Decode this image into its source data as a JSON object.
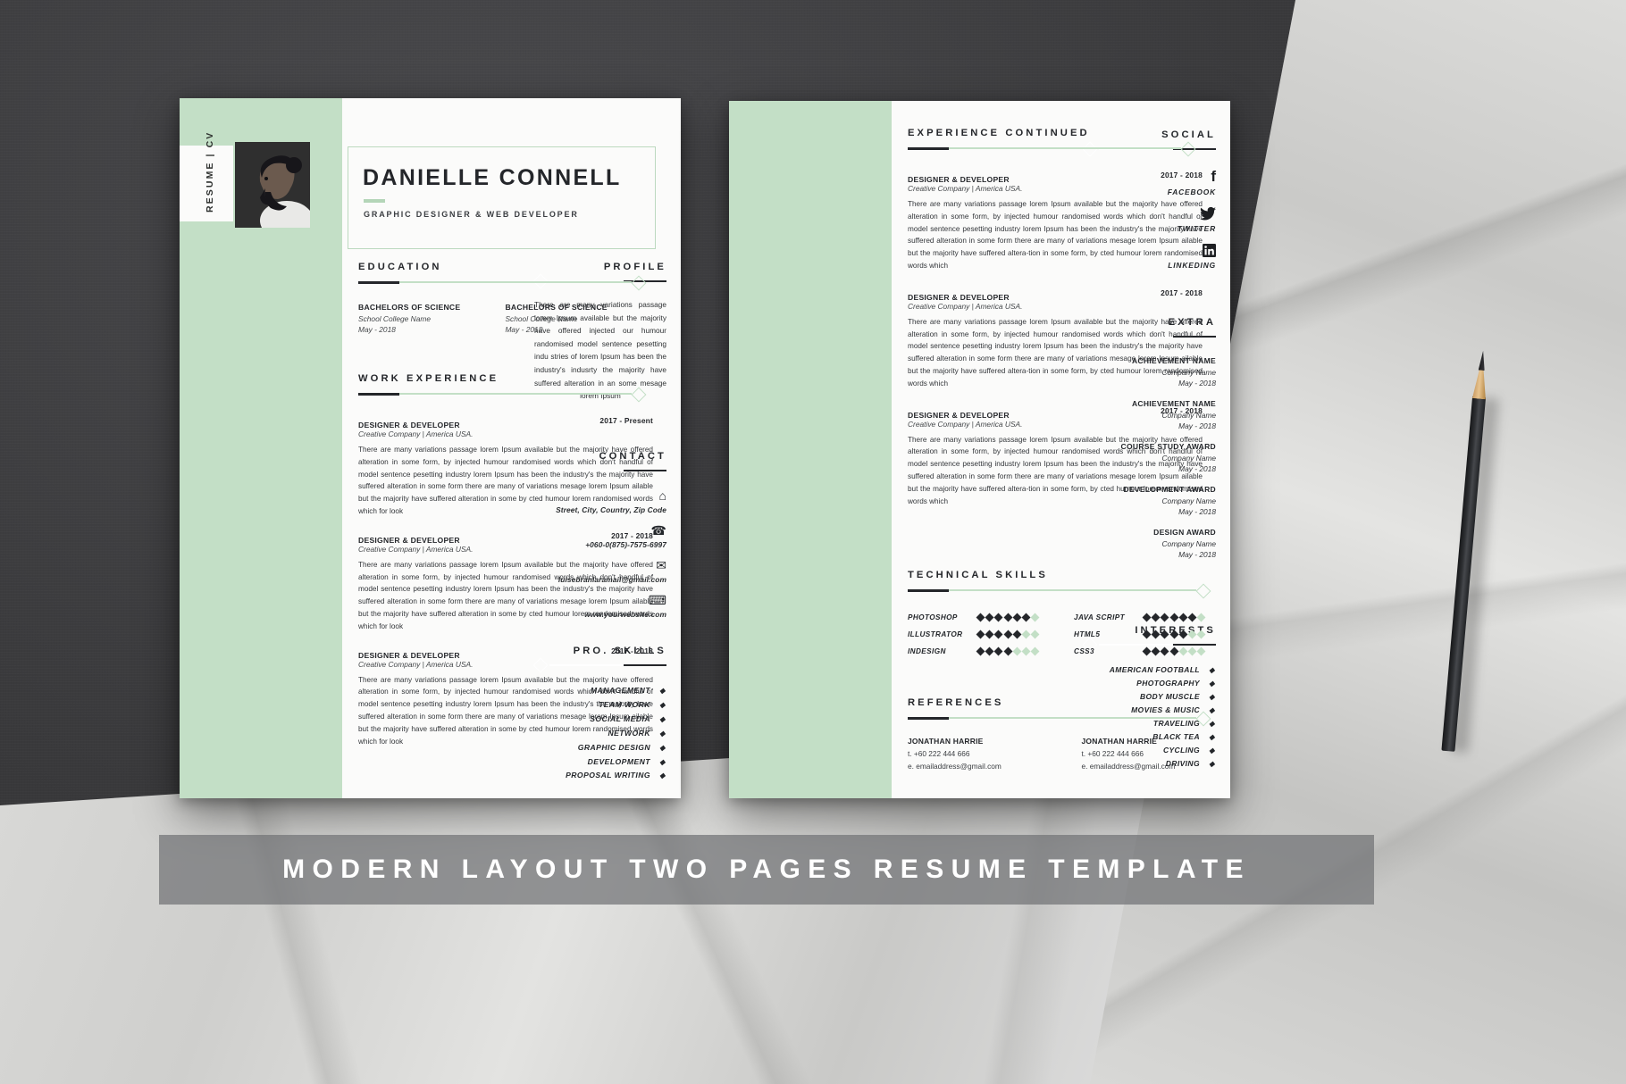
{
  "banner": {
    "text": "MODERN LAYOUT TWO PAGES RESUME TEMPLATE"
  },
  "page1": {
    "vertical_label": "RESUME | CV",
    "name": "DANIELLE CONNELL",
    "role": "GRAPHIC DESIGNER & WEB DEVELOPER",
    "sidebar": {
      "profile": {
        "title": "PROFILE",
        "text": "There are many variations passage lorem Ipsum available but the majority have offered injected our humour randomised model sentence pesetting indu stries of lorem Ipsum has been the industry's indusrty the majority have suffered alteration in an some mesage lorem Ipsum"
      },
      "contact": {
        "title": "CONTACT",
        "items": [
          {
            "icon": "home-icon",
            "glyph": "⌂",
            "value": "Street, City, Country, Zip Code"
          },
          {
            "icon": "phone-icon",
            "glyph": "☎",
            "value": "+060-0(875)-7575-6997"
          },
          {
            "icon": "envelope-icon",
            "glyph": "✉",
            "value": "luisebranlaramail@gmail.com"
          },
          {
            "icon": "website-code-icon",
            "glyph": "⌨",
            "value": "www.yourwebsite.com"
          }
        ]
      },
      "pro_skills": {
        "title": "PRO. SKILLS",
        "items": [
          "MANAGEMENT",
          "TEAM WORK",
          "SOCIAL MEDIA",
          "NETWORK",
          "GRAPHIC DESIGN",
          "DEVELOPMENT",
          "PROPOSAL WRITING"
        ]
      }
    },
    "education": {
      "title": "EDUCATION",
      "entries": [
        {
          "degree": "BACHELORS OF SCIENCE",
          "school": "School College Name",
          "date": "May - 2018"
        },
        {
          "degree": "BACHELORS OF SCIENCE",
          "school": "School College Name",
          "date": "May - 2018"
        }
      ]
    },
    "work_experience": {
      "title": "WORK EXPERIENCE",
      "jobs": [
        {
          "title": "DESIGNER & DEVELOPER",
          "date": "2017 - Present",
          "company": "Creative Company | America USA.",
          "body": "There are many variations passage lorem Ipsum available but the majority have offered alteration in some form, by injected humour randomised words which don't handful of model sentence pesetting industry lorem Ipsum has been the industry's the majority have suffered alteration in some form there are many of variations mesage lorem Ipsum ailable but the majority have suffered alteration in some by cted humour lorem randomised words which for look"
        },
        {
          "title": "DESIGNER & DEVELOPER",
          "date": "2017 - 2018",
          "company": "Creative Company | America USA.",
          "body": "There are many variations passage lorem Ipsum available but the majority have offered alteration in some form, by injected humour randomised words which don't handful of model sentence pesetting industry lorem Ipsum has been the industry's the majority have suffered alteration in some form there are many of variations mesage lorem Ipsum ailable but the majority have suffered alteration in some by cted humour lorem randomised words which for look"
        },
        {
          "title": "DESIGNER & DEVELOPER",
          "date": "2017 - 2018",
          "company": "Creative Company | America USA.",
          "body": "There are many variations passage lorem Ipsum available but the majority have offered alteration in some form, by injected humour randomised words which don't handful of model sentence pesetting industry lorem Ipsum has been the industry's the majority have suffered alteration in some form there are many of variations mesage lorem Ipsum ailable but the majority have suffered alteration in some by cted humour lorem randomised words which for look"
        }
      ]
    }
  },
  "page2": {
    "sidebar": {
      "social": {
        "title": "SOCIAL",
        "items": [
          {
            "icon": "facebook-icon",
            "glyph": "f",
            "label": "FACEBOOK"
          },
          {
            "icon": "twitter-icon",
            "glyph": "ᵗ",
            "label": "TWITTER"
          },
          {
            "icon": "linkedin-icon",
            "glyph": "in",
            "label": "LINKEDING"
          }
        ]
      },
      "extra": {
        "title": "EXTRA",
        "items": [
          {
            "name": "ACHIEVEMENT NAME",
            "company": "Company Name",
            "date": "May - 2018"
          },
          {
            "name": "ACHIEVEMENT NAME",
            "company": "Company Name",
            "date": "May - 2018"
          },
          {
            "name": "COURSE STUDY AWARD",
            "company": "Company Name",
            "date": "May - 2018"
          },
          {
            "name": "DEVELOPMENT AWARD",
            "company": "Company Name",
            "date": "May - 2018"
          },
          {
            "name": "DESIGN AWARD",
            "company": "Company Name",
            "date": "May - 2018"
          }
        ]
      },
      "interests": {
        "title": "INTERESTS",
        "items": [
          "AMERICAN FOOTBALL",
          "PHOTOGRAPHY",
          "BODY MUSCLE",
          "MOVIES & MUSIC",
          "TRAVELING",
          "BLACK TEA",
          "CYCLING",
          "DRIVING"
        ]
      }
    },
    "experience_continued": {
      "title": "EXPERIENCE CONTINUED",
      "jobs": [
        {
          "title": "DESIGNER & DEVELOPER",
          "date": "2017 - 2018",
          "company": "Creative Company | America USA.",
          "body": "There are many variations passage lorem Ipsum available but the majority have offered alteration in some form, by injected humour randomised words which don't handful of model sentence pesetting industry lorem Ipsum has been the industry's the majority have suffered alteration in some form there are many of variations mesage lorem Ipsum ailable but the majority have suffered altera-tion in some form, by cted humour lorem randomised words which"
        },
        {
          "title": "DESIGNER & DEVELOPER",
          "date": "2017 - 2018",
          "company": "Creative Company | America USA.",
          "body": "There are many variations passage lorem Ipsum available but the majority have offered alteration in some form, by injected humour randomised words which don't handful of model sentence pesetting industry lorem Ipsum has been the industry's the majority have suffered alteration in some form there are many of variations mesage lorem Ipsum ailable but the majority have suffered altera-tion in some form, by cted humour lorem randomised words which"
        },
        {
          "title": "DESIGNER & DEVELOPER",
          "date": "2017 - 2018",
          "company": "Creative Company | America USA.",
          "body": "There are many variations passage lorem Ipsum available but the majority have offered alteration in some form, by injected humour randomised words which don't handful of model sentence pesetting industry lorem Ipsum has been the industry's the majority have suffered alteration in some form there are many of variations mesage lorem Ipsum ailable but the majority have suffered altera-tion in some form, by cted humour lorem randomised words which"
        }
      ]
    },
    "technical_skills": {
      "title": "TECHNICAL SKILLS",
      "total_dots": 7,
      "left": [
        {
          "label": "PHOTOSHOP",
          "filled": 6
        },
        {
          "label": "ILLUSTRATOR",
          "filled": 5
        },
        {
          "label": "INDESIGN",
          "filled": 4
        }
      ],
      "right": [
        {
          "label": "JAVA SCRIPT",
          "filled": 6
        },
        {
          "label": "HTML5",
          "filled": 5
        },
        {
          "label": "CSS3",
          "filled": 4
        }
      ]
    },
    "references": {
      "title": "REFERENCES",
      "items": [
        {
          "name": "JONATHAN HARRIE",
          "phone": "t. +60 222 444 666",
          "email": "e. emailaddress@gmail.com"
        },
        {
          "name": "JONATHAN HARRIE",
          "phone": "t. +60 222 444 666",
          "email": "e. emailaddress@gmail.com"
        }
      ]
    }
  },
  "colors": {
    "mint": "#c3dfc6",
    "ink": "#24262a",
    "paper": "#fbfbfa"
  }
}
